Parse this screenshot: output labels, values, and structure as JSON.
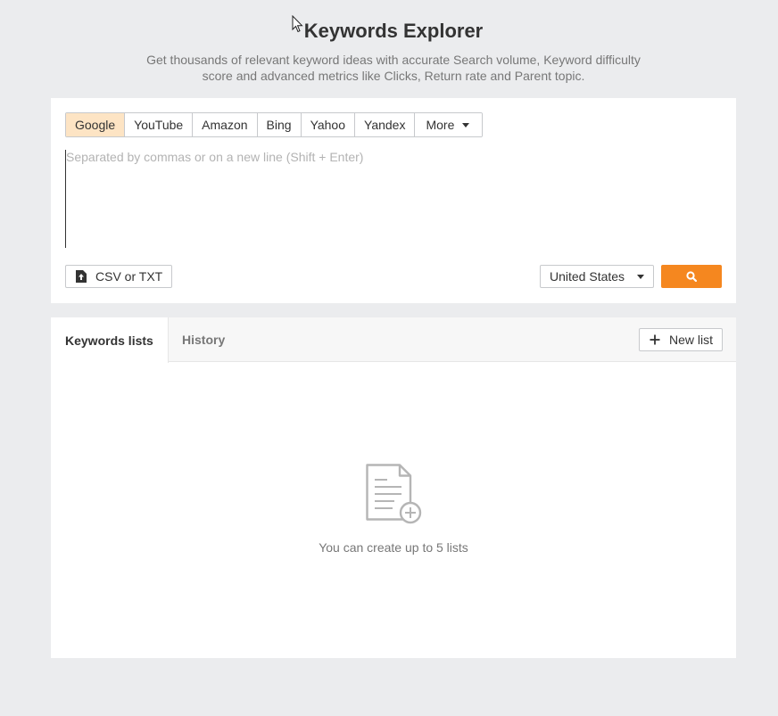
{
  "header": {
    "title": "Keywords Explorer",
    "subtitle": "Get thousands of relevant keyword ideas with accurate Search volume, Keyword difficulty score and advanced metrics like Clicks, Return rate and Parent topic."
  },
  "search": {
    "engines": [
      "Google",
      "YouTube",
      "Amazon",
      "Bing",
      "Yahoo",
      "Yandex"
    ],
    "active_engine": "Google",
    "more_label": "More",
    "placeholder": "Separated by commas or on a new line (Shift + Enter)",
    "value": "",
    "upload_label": "CSV or TXT",
    "country": "United States"
  },
  "lists": {
    "tabs": [
      "Keywords lists",
      "History"
    ],
    "active_tab": "Keywords lists",
    "new_list_label": "New list",
    "empty_message": "You can create up to 5 lists"
  },
  "colors": {
    "accent": "#f5871f",
    "active_tab_bg": "#fde4c4",
    "page_bg": "#ebecee"
  },
  "icons": {
    "cursor": "mouse-cursor-icon",
    "upload": "upload-file-icon",
    "search": "search-icon",
    "new_list": "plus-icon",
    "empty_state": "document-add-icon"
  }
}
